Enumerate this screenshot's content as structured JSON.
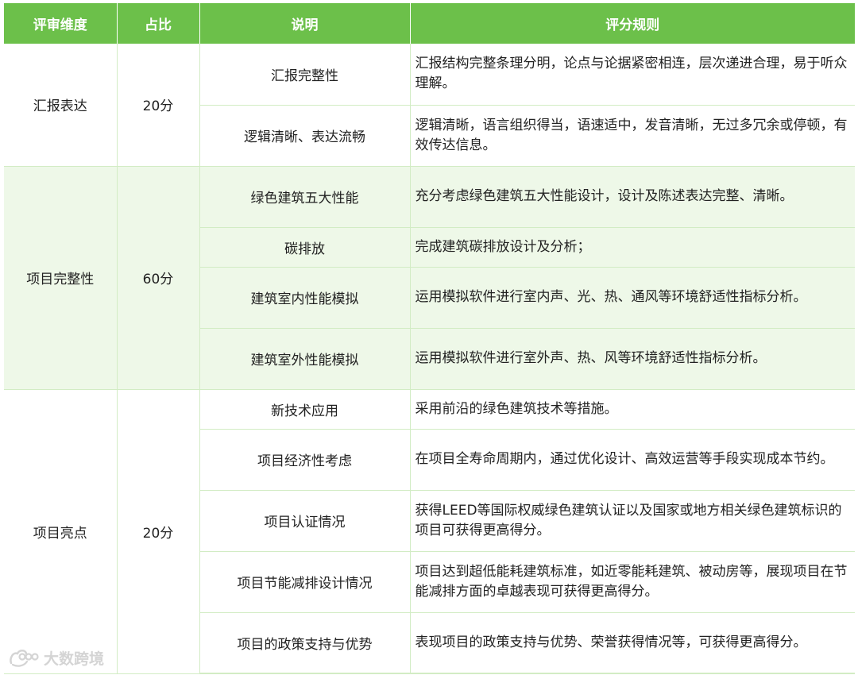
{
  "header": {
    "col1": "评审维度",
    "col2": "占比",
    "col3": "说明",
    "col4": "评分规则"
  },
  "groups": [
    {
      "dimension": "汇报表达",
      "weight": "20分",
      "rows": [
        {
          "item": "汇报完整性",
          "rule": "汇报结构完整条理分明，论点与论据紧密相连，层次递进合理，易于听众理解。"
        },
        {
          "item": "逻辑清晰、表达流畅",
          "rule": "逻辑清晰，语言组织得当，语速适中，发音清晰，无过多冗余或停顿，有效传达信息。"
        }
      ]
    },
    {
      "dimension": "项目完整性",
      "weight": "60分",
      "rows": [
        {
          "item": "绿色建筑五大性能",
          "rule": "充分考虑绿色建筑五大性能设计，设计及陈述表达完整、清晰。"
        },
        {
          "item": "碳排放",
          "rule": "完成建筑碳排放设计及分析；"
        },
        {
          "item": "建筑室内性能模拟",
          "rule": "运用模拟软件进行室内声、光、热、通风等环境舒适性指标分析。"
        },
        {
          "item": "建筑室外性能模拟",
          "rule": "运用模拟软件进行室外声、热、风等环境舒适性指标分析。"
        }
      ]
    },
    {
      "dimension": "项目亮点",
      "weight": "20分",
      "rows": [
        {
          "item": "新技术应用",
          "rule": "采用前沿的绿色建筑技术等措施。"
        },
        {
          "item": "项目经济性考虑",
          "rule": "在项目全寿命周期内，通过优化设计、高效运营等手段实现成本节约。"
        },
        {
          "item": "项目认证情况",
          "rule": "获得LEED等国际权威绿色建筑认证以及国家或地方相关绿色建筑标识的项目可获得更高得分。"
        },
        {
          "item": "项目节能减排设计情况",
          "rule": "项目达到超低能耗建筑标准，如近零能耗建筑、被动房等，展现项目在节能减排方面的卓越表现可获得更高得分。"
        },
        {
          "item": "项目的政策支持与优势",
          "rule": "表现项目的政策支持与优势、荣誉获得情况等，可获得更高得分。"
        }
      ]
    }
  ],
  "watermark": {
    "text": "大数跨境",
    "icon": "brand-logo-icon"
  }
}
